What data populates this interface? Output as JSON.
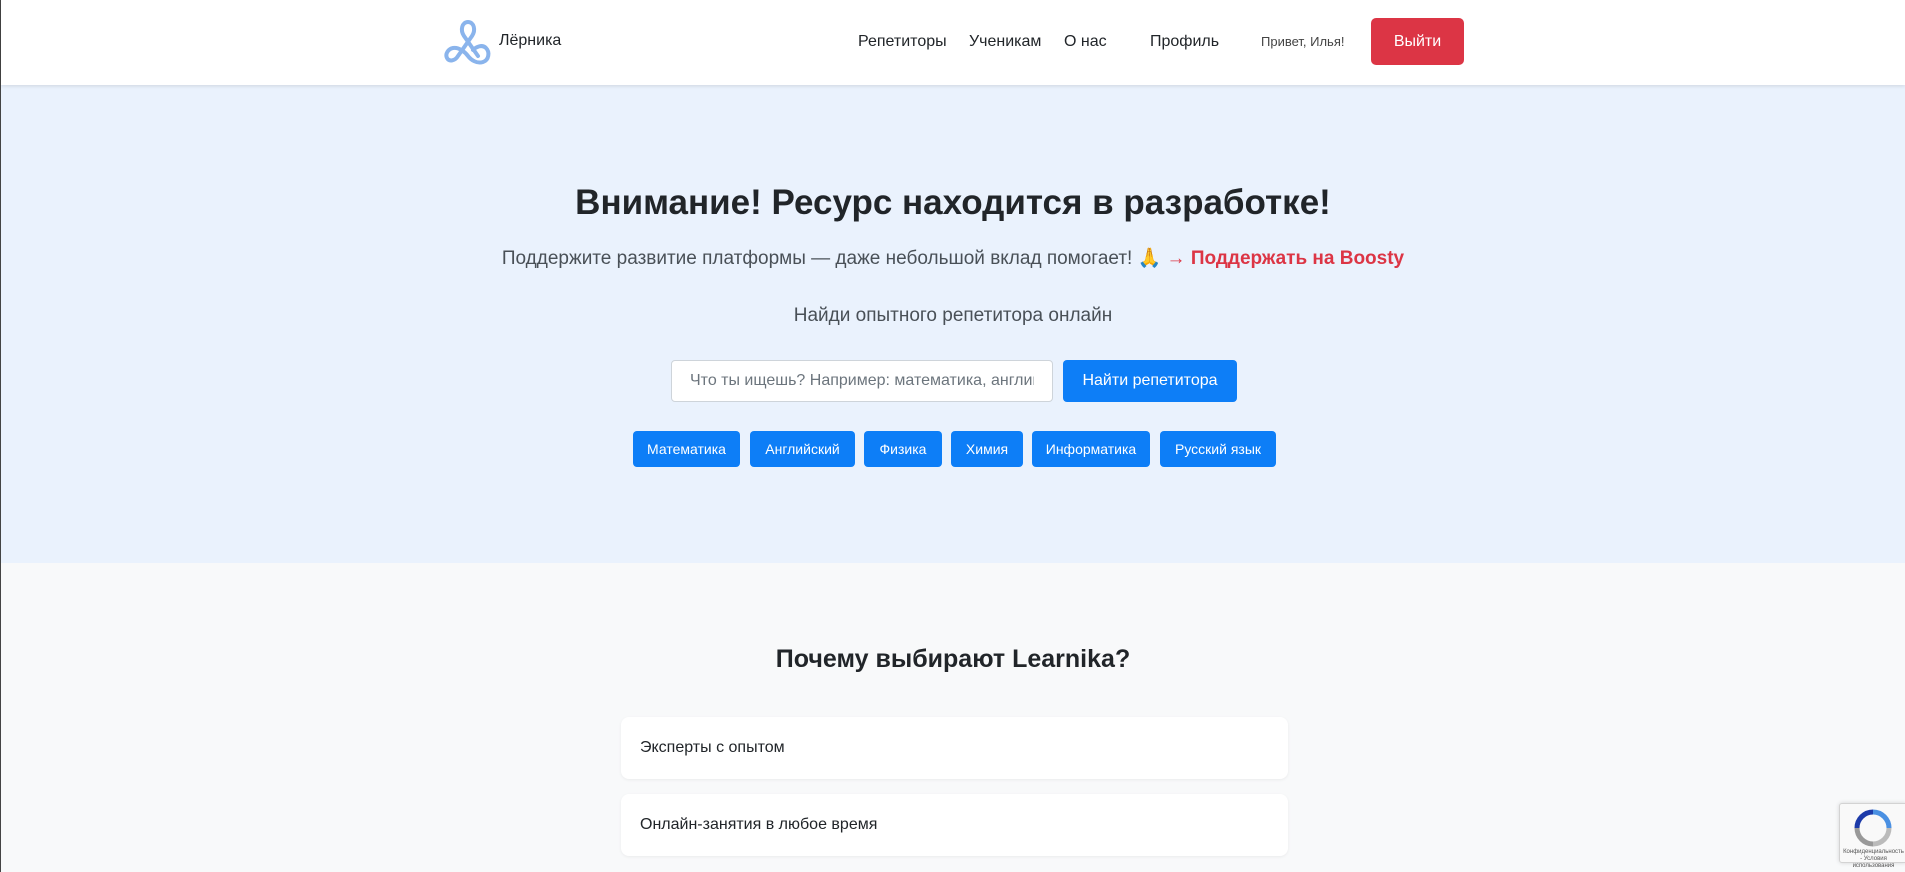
{
  "header": {
    "logo_text": "Лёрника",
    "nav": [
      "Репетиторы",
      "Ученикам",
      "О нас",
      "Профиль"
    ],
    "greeting": "Привет, Илья!",
    "logout_label": "Выйти"
  },
  "hero": {
    "title": "Внимание! Ресурс находится в разработке!",
    "support_text": "Поддержите развитие платформы — даже небольшой вклад помогает! 🙏",
    "support_arrow": "→",
    "support_link": "Поддержать на Boosty",
    "tagline": "Найди опытного репетитора онлайн",
    "search_placeholder": "Что ты ищешь? Например: математика, английский",
    "search_button": "Найти репетитора",
    "tags": [
      "Математика",
      "Английский",
      "Физика",
      "Химия",
      "Информатика",
      "Русский язык"
    ]
  },
  "why": {
    "title": "Почему выбирают Learnika?",
    "features": [
      "Эксперты с опытом",
      "Онлайн-занятия в любое время"
    ]
  },
  "recaptcha": {
    "text": "Конфиденциальность - Условия использования"
  },
  "colors": {
    "accent": "#0d7ef7",
    "danger": "#dc3545",
    "hero_bg": "#eaf2fd"
  }
}
